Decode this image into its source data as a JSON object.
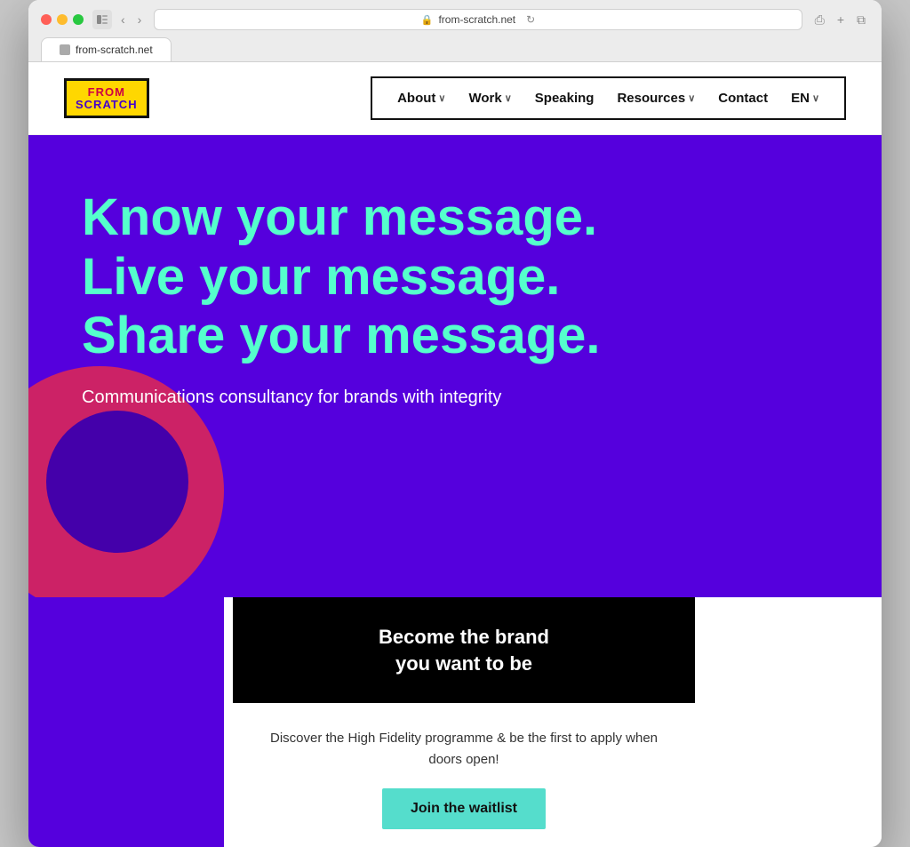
{
  "browser": {
    "url": "from-scratch.net",
    "tab_label": "from-scratch.net"
  },
  "logo": {
    "from": "FROM",
    "scratch": "SCRATCH"
  },
  "nav": {
    "items": [
      {
        "label": "About",
        "has_dropdown": true
      },
      {
        "label": "Work",
        "has_dropdown": true
      },
      {
        "label": "Speaking",
        "has_dropdown": false
      },
      {
        "label": "Resources",
        "has_dropdown": true
      },
      {
        "label": "Contact",
        "has_dropdown": false
      },
      {
        "label": "EN",
        "has_dropdown": true
      }
    ]
  },
  "hero": {
    "headline": "Know your message. Live your message. Share your message.",
    "subheadline": "Communications consultancy for brands with integrity"
  },
  "cta": {
    "title": "Become the brand\nyou want to be",
    "description": "Discover the High Fidelity programme & be the first to apply when doors open!",
    "button_label": "Join the waitlist"
  }
}
